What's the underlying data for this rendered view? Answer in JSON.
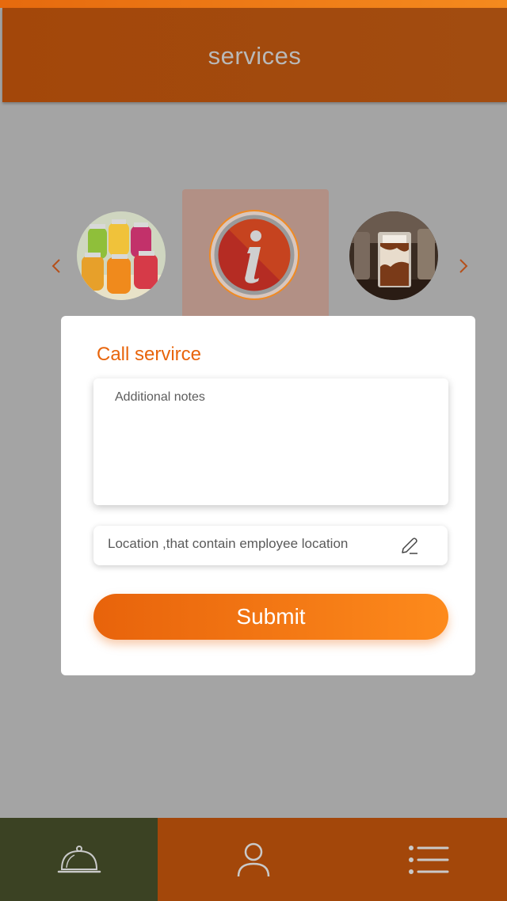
{
  "header": {
    "title": "services"
  },
  "carousel": {
    "left_arrow_icon": "chevron-left-icon",
    "right_arrow_icon": "chevron-right-icon",
    "items": [
      {
        "name": "juices",
        "selected": false
      },
      {
        "name": "info",
        "selected": true,
        "icon": "info-icon"
      },
      {
        "name": "iced-coffee",
        "selected": false
      }
    ]
  },
  "form": {
    "title": "Call servirce",
    "notes_placeholder": "Additional notes",
    "location_text": "Location ,that contain employee location",
    "location_icon": "edit-icon",
    "submit_label": "Submit"
  },
  "bottom_nav": {
    "items": [
      {
        "name": "services",
        "icon": "food-cloche-icon",
        "active": true
      },
      {
        "name": "profile",
        "icon": "user-icon",
        "active": false
      },
      {
        "name": "menu",
        "icon": "list-icon",
        "active": false
      }
    ]
  },
  "colors": {
    "accent": "#e8650c",
    "header": "#a3470a",
    "active_nav": "#3b4223",
    "overlay": "#a4a4a4"
  }
}
